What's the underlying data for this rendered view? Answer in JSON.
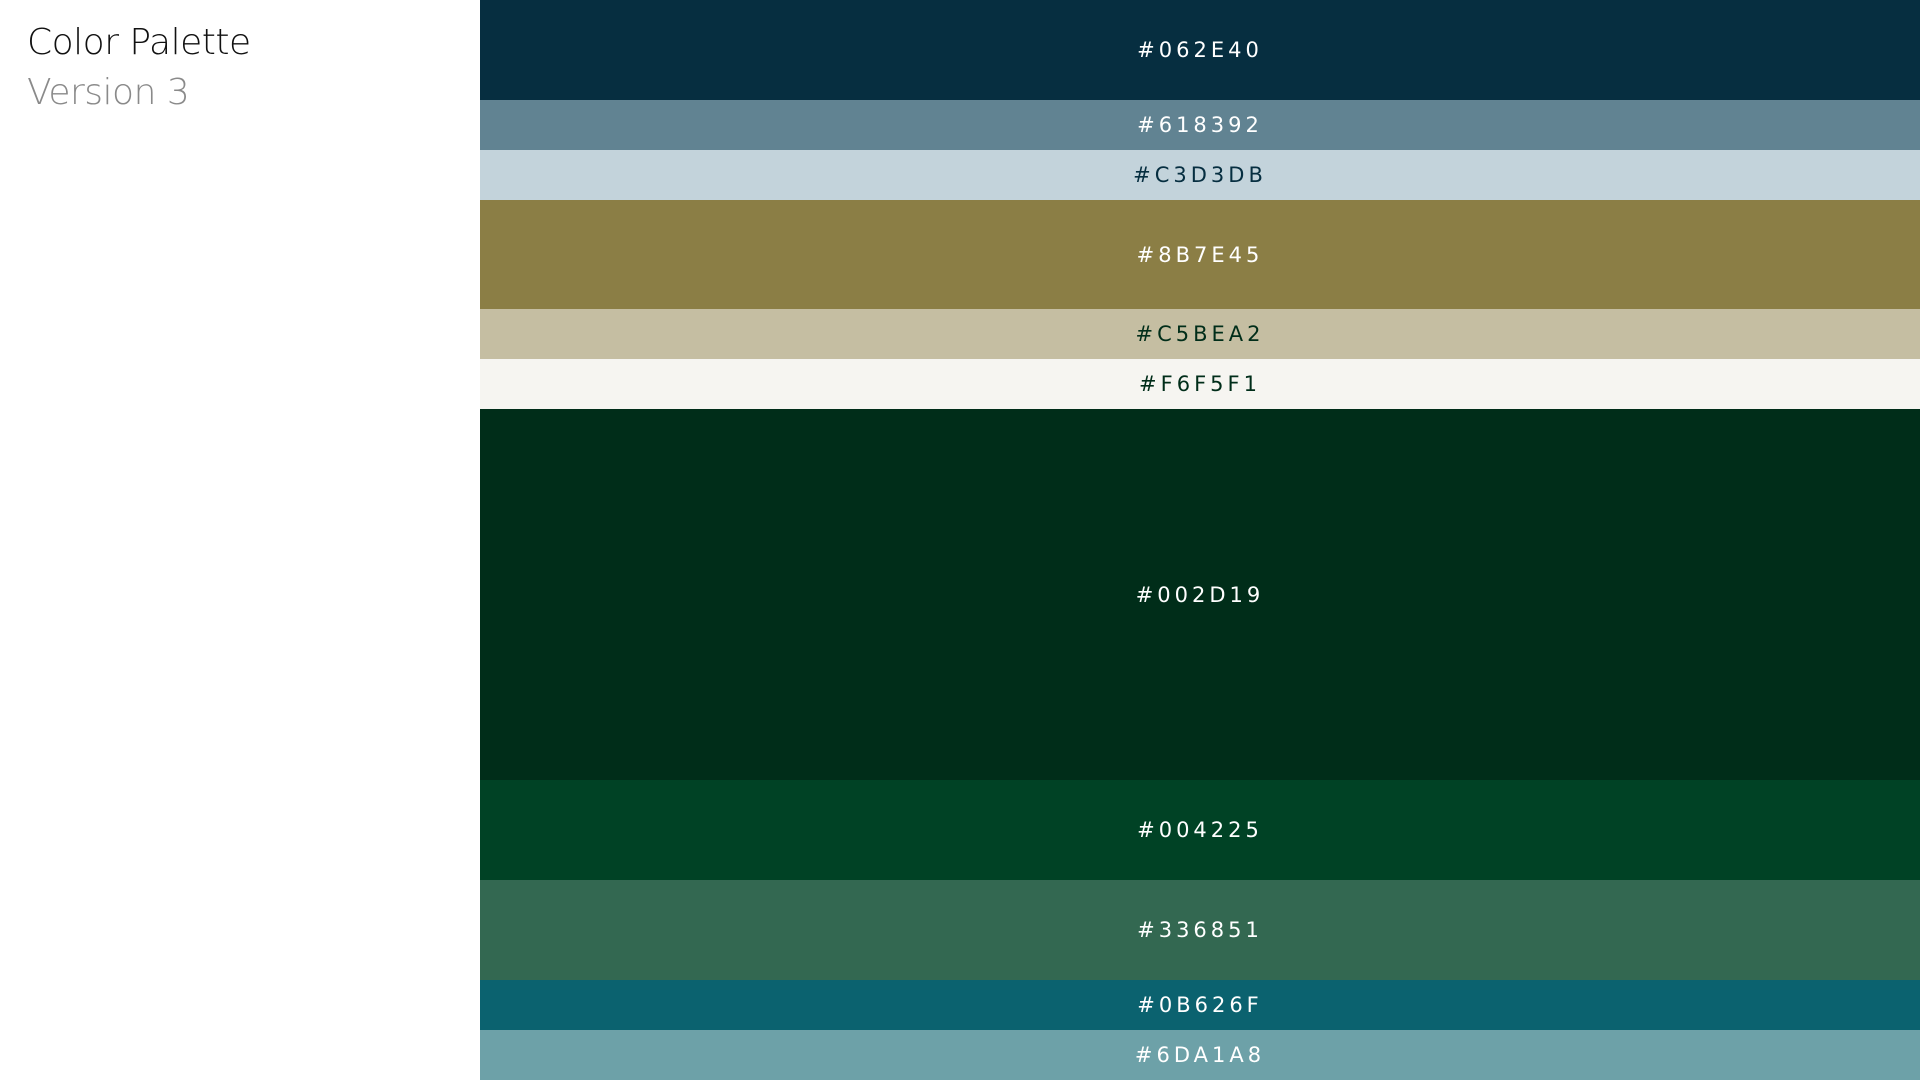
{
  "header": {
    "title": "Color Palette",
    "subtitle": "Version 3"
  },
  "swatches": [
    {
      "label": "#062E40",
      "color": "#062E40",
      "text_color": "#FFFFFF"
    },
    {
      "label": "#618392",
      "color": "#618392",
      "text_color": "#FFFFFF"
    },
    {
      "label": "#C3D3DB",
      "color": "#C3D3DB",
      "text_color": "#062E40"
    },
    {
      "label": "#8B7E45",
      "color": "#8B7E45",
      "text_color": "#FFFFFF"
    },
    {
      "label": "#C5BEA2",
      "color": "#C5BEA2",
      "text_color": "#002D19"
    },
    {
      "label": "#F6F5F1",
      "color": "#F6F5F1",
      "text_color": "#002D19"
    },
    {
      "label": "#002D19",
      "color": "#002D19",
      "text_color": "#FFFFFF"
    },
    {
      "label": "#004225",
      "color": "#004225",
      "text_color": "#FFFFFF"
    },
    {
      "label": "#336851",
      "color": "#336851",
      "text_color": "#FFFFFF"
    },
    {
      "label": "#0B626F",
      "color": "#0B626F",
      "text_color": "#FFFFFF"
    },
    {
      "label": "#6DA1A8",
      "color": "#6DA1A8",
      "text_color": "#FFFFFF"
    }
  ]
}
